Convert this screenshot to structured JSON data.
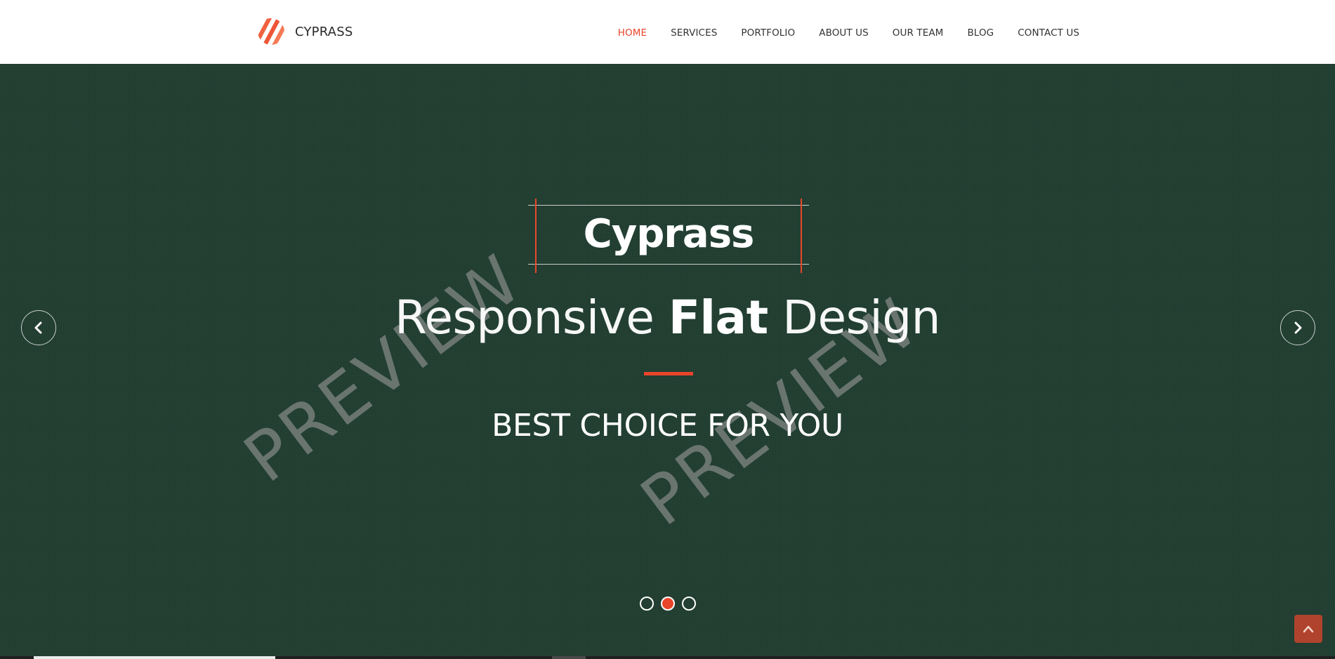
{
  "brand": {
    "name": "CYPRASS",
    "logo_icon": "striped-circle-logo-icon"
  },
  "nav": {
    "items": [
      {
        "label": "HOME",
        "active": true
      },
      {
        "label": "SERVICES",
        "active": false
      },
      {
        "label": "PORTFOLIO",
        "active": false
      },
      {
        "label": "ABOUT US",
        "active": false
      },
      {
        "label": "OUR TEAM",
        "active": false
      },
      {
        "label": "BLOG",
        "active": false
      },
      {
        "label": "CONTACT US",
        "active": false
      }
    ]
  },
  "hero": {
    "title": "Cyprass",
    "tagline": {
      "part1": "Responsive ",
      "part2_bold": "Flat",
      "part3": " Design"
    },
    "subtitle": "BEST CHOICE FOR YOU",
    "watermark_text": "PREVIEW",
    "prev_icon": "chevron-left-icon",
    "next_icon": "chevron-right-icon",
    "slides_total": 3,
    "active_slide": 2,
    "back_to_top_icon": "chevron-up-icon"
  },
  "colors": {
    "accent": "#e9452a",
    "hero_background": "#244235",
    "nav_text": "#333333",
    "back_to_top": "#b0432d"
  }
}
